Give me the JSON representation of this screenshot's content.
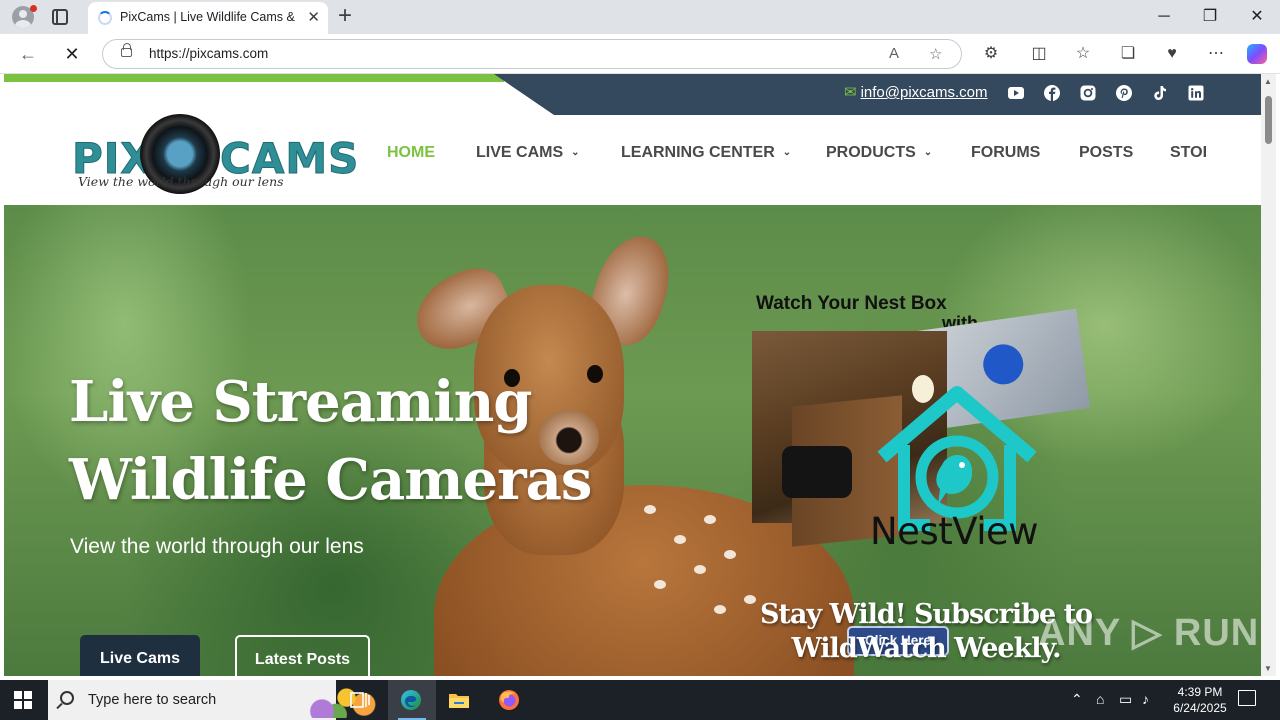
{
  "browser": {
    "tab_title": "PixCams | Live Wildlife Cams & Na",
    "url": "https://pixcams.com",
    "new_tab": "+",
    "tab_close": "✕",
    "minimize": "─",
    "restore": "❐",
    "close": "✕"
  },
  "site": {
    "email": "info@pixcams.com",
    "logo": {
      "word_left": "PIX",
      "word_right": "CAMS",
      "tagline": "View the world through our lens"
    },
    "nav": [
      {
        "label": "HOME",
        "active": true
      },
      {
        "label": "LIVE CAMS",
        "dropdown": true
      },
      {
        "label": "LEARNING CENTER",
        "dropdown": true
      },
      {
        "label": "PRODUCTS",
        "dropdown": true
      },
      {
        "label": "FORUMS"
      },
      {
        "label": "POSTS"
      },
      {
        "label": "STOI"
      }
    ],
    "social": [
      "youtube-icon",
      "facebook-icon",
      "instagram-icon",
      "pinterest-icon",
      "tiktok-icon",
      "linkedin-icon"
    ]
  },
  "hero": {
    "title_line1": "Live Streaming",
    "title_line2": "Wildlife Cameras",
    "subtitle": "View the world through our lens",
    "btn_live": "Live Cams",
    "btn_posts": "Latest Posts"
  },
  "promo": {
    "watch": "Watch Your Nest Box",
    "with": "with",
    "brand": "NestView",
    "click": "Click Here",
    "stay_line1": "Stay Wild! Subscribe to",
    "stay_line2": "WildWatch Weekly."
  },
  "watermark": "ANY ▷ RUN",
  "taskbar": {
    "search_placeholder": "Type here to search",
    "time": "4:39 PM",
    "date": "6/24/2025"
  },
  "colors": {
    "accent_green": "#7cc242",
    "topbar_navy": "#34495e",
    "nestview_teal": "#1fc8c8",
    "button_navy": "#1e2f3f"
  }
}
